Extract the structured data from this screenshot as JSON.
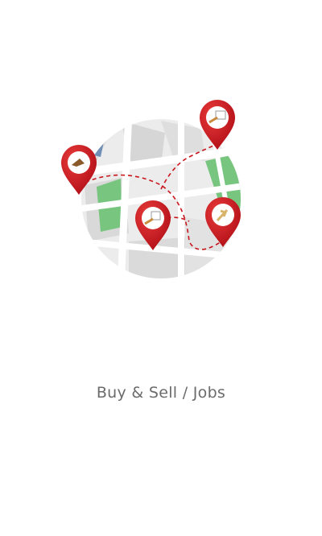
{
  "onboarding": {
    "illustration": {
      "icon": "map-with-location-pins-illustration",
      "pins": [
        {
          "name": "map-pin-tools-icon",
          "color": "#c8151c"
        },
        {
          "name": "map-pin-jobs-icon",
          "color": "#c8151c"
        },
        {
          "name": "map-pin-sale-icon",
          "color": "#c8151c"
        },
        {
          "name": "map-pin-item-icon",
          "color": "#c8151c"
        }
      ],
      "colors": {
        "map_background": "#eeeeee",
        "road": "#ffffff",
        "block": "#dadada",
        "park": "#77c57e",
        "water": "#6f8fb7",
        "route": "#c8151c"
      }
    },
    "caption": "Buy & Sell / Jobs"
  }
}
